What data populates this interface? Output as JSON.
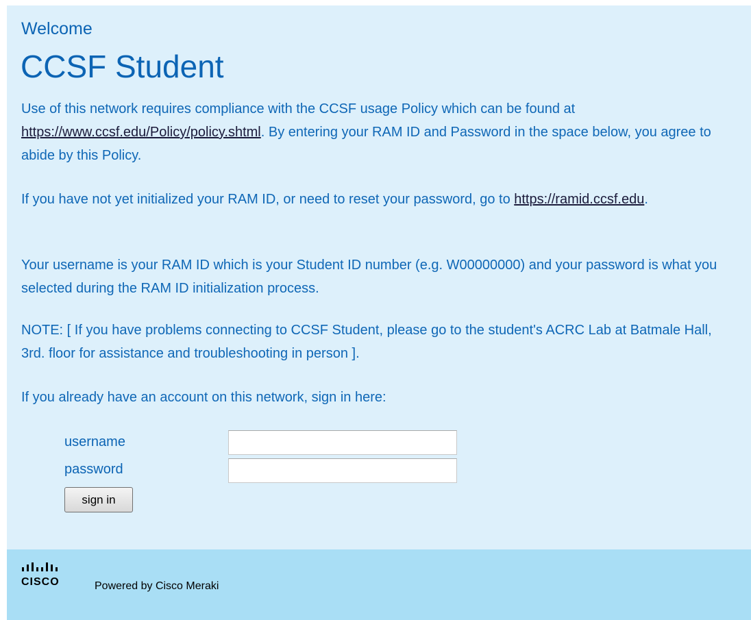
{
  "header": {
    "welcome": "Welcome",
    "title": "CCSF Student"
  },
  "policy": {
    "text_before": "Use of this network requires compliance with the CCSF usage Policy which can be found at ",
    "link": "https://www.ccsf.edu/Policy/policy.shtml",
    "text_after": ". By entering your RAM ID and Password in the space below, you agree to abide by this Policy."
  },
  "reset": {
    "text_before": "If you have not yet initialized your RAM ID, or need to reset your password, go to ",
    "link": "https://ramid.ccsf.edu",
    "text_after": "."
  },
  "username_info": "Your username is your RAM ID which is your Student ID number (e.g. W00000000) and your password is what you selected during the RAM ID initialization process.",
  "note": "NOTE: [ If you have problems connecting to CCSF Student, please go to the student's ACRC Lab at Batmale Hall, 3rd. floor for assistance and troubleshooting in person ].",
  "signin_prompt": "If you already have an account on this network, sign in here:",
  "form": {
    "username_label": "username",
    "password_label": "password",
    "username_value": "",
    "password_value": "",
    "submit_label": "sign in"
  },
  "footer": {
    "logo_icon": "cisco-logo-icon",
    "logo_text": "CISCO",
    "powered_by": "Powered by Cisco Meraki"
  },
  "colors": {
    "panel_bg": "#ddf0fb",
    "footer_bg": "#a9def5",
    "text_blue": "#0c64b4"
  }
}
